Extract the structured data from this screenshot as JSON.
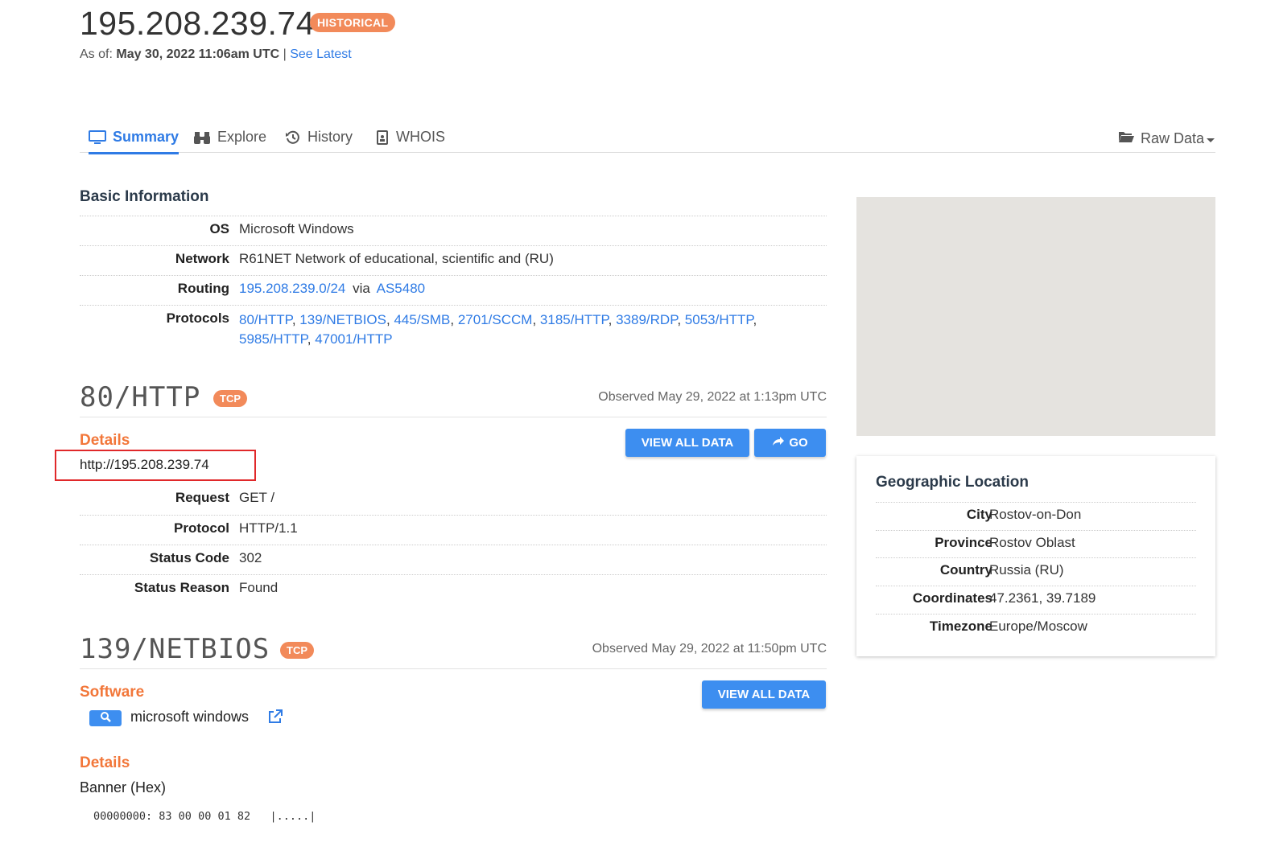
{
  "header": {
    "ip": "195.208.239.74",
    "badge": "HISTORICAL",
    "as_of_label": "As of:",
    "as_of_value": "May 30, 2022 11:06am UTC",
    "separator": "|",
    "see_latest": "See Latest"
  },
  "tabs": [
    {
      "label": "Summary",
      "icon": "monitor-icon",
      "active": true
    },
    {
      "label": "Explore",
      "icon": "binoculars-icon",
      "active": false
    },
    {
      "label": "History",
      "icon": "history-icon",
      "active": false
    },
    {
      "label": "WHOIS",
      "icon": "id-card-icon",
      "active": false
    }
  ],
  "raw_data": {
    "label": "Raw Data",
    "icon": "folder-open-icon"
  },
  "basic_info": {
    "title": "Basic Information",
    "os_label": "OS",
    "os_value": "Microsoft Windows",
    "network_label": "Network",
    "network_value": "R61NET Network of educational, scientific and (RU)",
    "routing_label": "Routing",
    "routing_prefix": "195.208.239.0/24",
    "routing_via": "via",
    "routing_asn": "AS5480",
    "protocols_label": "Protocols",
    "protocols": [
      "80/HTTP",
      "139/NETBIOS",
      "445/SMB",
      "2701/SCCM",
      "3185/HTTP",
      "3389/RDP",
      "5053/HTTP",
      "5985/HTTP",
      "47001/HTTP"
    ]
  },
  "service_http": {
    "title": "80/HTTP",
    "badge": "TCP",
    "observed": "Observed May 29, 2022 at 1:13pm UTC",
    "details_heading": "Details",
    "view_all_label": "VIEW ALL DATA",
    "go_label": "GO",
    "url": "http://195.208.239.74",
    "request_label": "Request",
    "request_value": "GET /",
    "protocol_label": "Protocol",
    "protocol_value": "HTTP/1.1",
    "status_code_label": "Status Code",
    "status_code_value": "302",
    "status_reason_label": "Status Reason",
    "status_reason_value": "Found"
  },
  "service_netbios": {
    "title": "139/NETBIOS",
    "badge": "TCP",
    "observed": "Observed May 29, 2022 at 11:50pm UTC",
    "software_heading": "Software",
    "view_all_label": "VIEW ALL DATA",
    "software_name": "microsoft windows",
    "details_heading": "Details",
    "banner_label": "Banner (Hex)",
    "banner_offset": "00000000:",
    "banner_bytes": "83 00 00 01 82",
    "banner_ascii": "|.....|"
  },
  "geo": {
    "title": "Geographic Location",
    "city_label": "City",
    "city_value": "Rostov-on-Don",
    "province_label": "Province",
    "province_value": "Rostov Oblast",
    "country_label": "Country",
    "country_value": "Russia (RU)",
    "coordinates_label": "Coordinates",
    "coordinates_value": "47.2361, 39.7189",
    "timezone_label": "Timezone",
    "timezone_value": "Europe/Moscow"
  },
  "colors": {
    "accent": "#2f7be5",
    "badge": "#f28a5a",
    "heading_orange": "#f2773a",
    "button": "#3d8ef0",
    "highlight": "#e0282a"
  }
}
